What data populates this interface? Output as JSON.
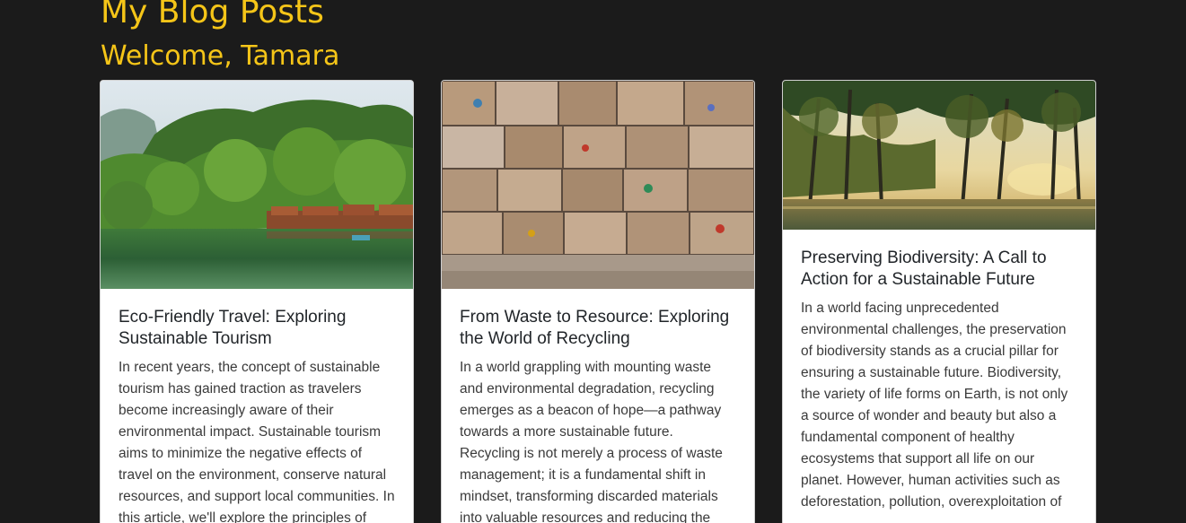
{
  "header": {
    "title": "My Blog Posts",
    "welcome": "Welcome, Tamara"
  },
  "colors": {
    "background": "#1b1b1b",
    "accent": "#f5c518",
    "card_background": "#ffffff"
  },
  "posts": [
    {
      "image": "forest-lake-image",
      "title": "Eco-Friendly Travel: Exploring Sustainable Tourism",
      "excerpt": "In recent years, the concept of sustainable tourism has gained traction as travelers become increasingly aware of their environmental impact. Sustainable tourism aims to minimize the negative effects of travel on the environment, conserve natural resources, and support local communities. In this article, we'll explore the principles of"
    },
    {
      "image": "recycling-bales-image",
      "title": "From Waste to Resource: Exploring the World of Recycling",
      "excerpt": "In a world grappling with mounting waste and environmental degradation, recycling emerges as a beacon of hope—a pathway towards a more sustainable future. Recycling is not merely a process of waste management; it is a fundamental shift in mindset, transforming discarded materials into valuable resources and reducing the"
    },
    {
      "image": "swamp-forest-image",
      "title": "Preserving Biodiversity: A Call to Action for a Sustainable Future",
      "excerpt": "In a world facing unprecedented environmental challenges, the preservation of biodiversity stands as a crucial pillar for ensuring a sustainable future. Biodiversity, the variety of life forms on Earth, is not only a source of wonder and beauty but also a fundamental component of healthy ecosystems that support all life on our planet. However, human activities such as deforestation, pollution, overexploitation of"
    }
  ]
}
